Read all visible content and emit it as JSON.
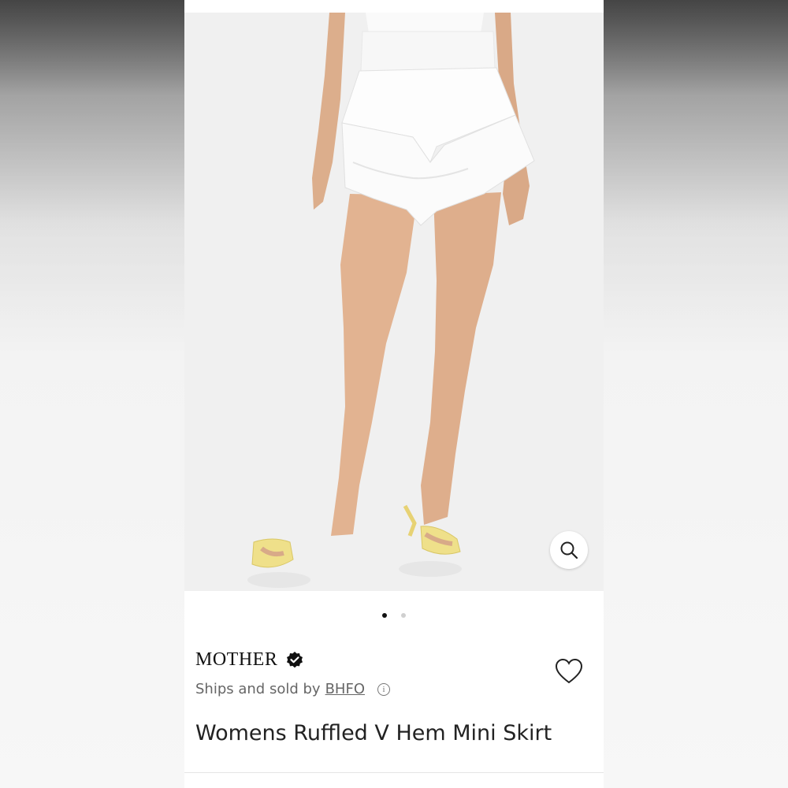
{
  "product": {
    "brand": "MOTHER",
    "seller_prefix": "Ships and sold by",
    "seller_name": "BHFO",
    "info_glyph": "i",
    "title": "Womens Ruffled V Hem Mini Skirt"
  },
  "gallery": {
    "image_count": 2,
    "active_index": 0,
    "image_alt": "Model wearing white ruffled mini skirt with yellow sandals"
  },
  "icons": {
    "verified": "verified-badge-icon",
    "zoom": "magnifier-icon",
    "favorite": "heart-outline-icon",
    "info": "info-circle-icon"
  },
  "colors": {
    "skirt": "#fbfbfb",
    "sandals": "#efe08a",
    "skin": "#e3b592",
    "backdrop": "#f0f0f0"
  }
}
